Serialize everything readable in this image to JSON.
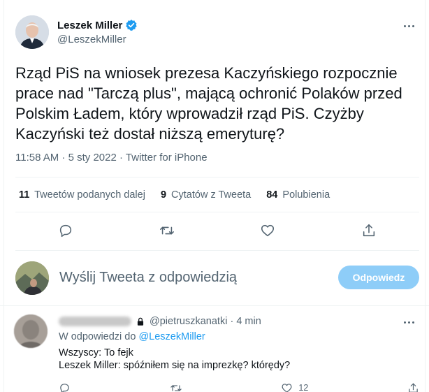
{
  "tweet": {
    "display_name": "Leszek Miller",
    "handle": "@LeszekMiller",
    "verified": true,
    "text": "Rząd PiS na wniosek prezesa Kaczyńskiego rozpocznie prace nad \"Tarczą plus\", mającą ochronić Polaków przed Polskim Ładem, który wprowadził rząd PiS. Czyżby Kaczyński też dostał niższą emeryturę?",
    "meta": "11:58 AM · 5 sty 2022 · Twitter for iPhone",
    "stats": [
      {
        "count": "11",
        "label": "Tweetów podanych dalej"
      },
      {
        "count": "9",
        "label": "Cytatów z Tweeta"
      },
      {
        "count": "84",
        "label": "Polubienia"
      }
    ],
    "actions": [
      "reply-icon",
      "retweet-icon",
      "like-icon",
      "share-icon"
    ]
  },
  "reply_box": {
    "placeholder": "Wyślij Tweeta z odpowiedzią",
    "button_label": "Odpowiedz"
  },
  "reply": {
    "handle_time": "@pietruszkanatki · 4 min",
    "reply_to_prefix": "W odpowiedzi do",
    "reply_to_handle": "@LeszekMiller",
    "lines": [
      "Wszyscy: To fejk",
      "Leszek Miller: spóźniłem się na imprezkę? którędy?"
    ],
    "like_count": "12"
  },
  "colors": {
    "accent": "#1d9bf0",
    "button_disabled": "#8ecdf8",
    "secondary_text": "#536471"
  }
}
